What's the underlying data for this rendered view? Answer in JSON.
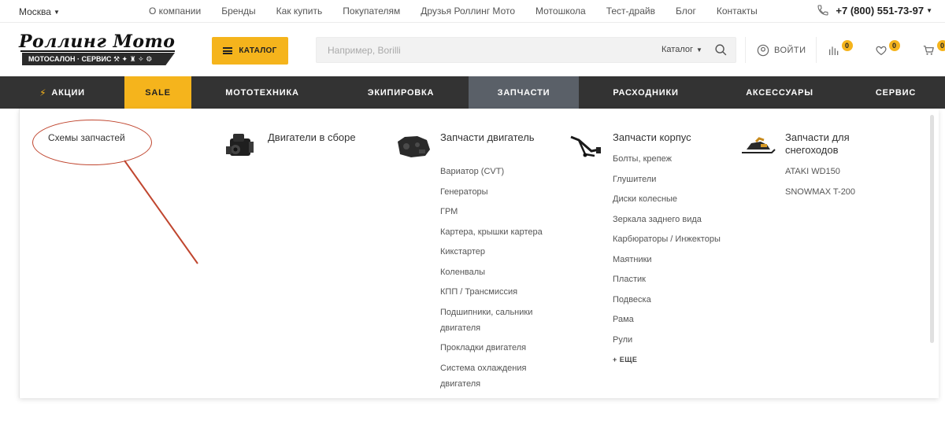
{
  "topbar": {
    "city": "Москва",
    "links": [
      "О компании",
      "Бренды",
      "Как купить",
      "Покупателям",
      "Друзья Роллинг Мото",
      "Мотошкола",
      "Тест-драйв",
      "Блог",
      "Контакты"
    ],
    "phone": "+7 (800) 551-73-97"
  },
  "logo": {
    "name": "Роллинг Мото",
    "tagline": "МОТОСАЛОН · СЕРВИС"
  },
  "header": {
    "catalog_label": "КАТАЛОГ",
    "search_placeholder": "Например, Borilli",
    "search_scope": "Каталог",
    "login_label": "ВОЙТИ",
    "compare_count": "0",
    "favorites_count": "0",
    "cart_count": "0"
  },
  "nav": [
    {
      "label": "АКЦИИ",
      "icon": "lightning-icon"
    },
    {
      "label": "SALE"
    },
    {
      "label": "МОТОТЕХНИКА"
    },
    {
      "label": "ЭКИПИРОВКА"
    },
    {
      "label": "ЗАПЧАСТИ"
    },
    {
      "label": "РАСХОДНИКИ"
    },
    {
      "label": "АКСЕССУАРЫ"
    },
    {
      "label": "СЕРВИС"
    }
  ],
  "dropdown": {
    "side_title": "Схемы запчастей",
    "columns": [
      {
        "title": "Двигатели в сборе",
        "image": "engine-assembly-image",
        "items": []
      },
      {
        "title": "Запчасти двигатель",
        "image": "engine-parts-image",
        "items": [
          "Вариатор (CVT)",
          "Генераторы",
          "ГРМ",
          "Картера, крышки картера",
          "Кикстартер",
          "Коленвалы",
          "КПП / Трансмиссия",
          "Подшипники, сальники двигателя",
          "Прокладки двигателя",
          "Система охлаждения двигателя"
        ]
      },
      {
        "title": "Запчасти корпус",
        "image": "frame-parts-image",
        "items": [
          "Болты, крепеж",
          "Глушители",
          "Диски колесные",
          "Зеркала заднего вида",
          "Карбюраторы / Инжекторы",
          "Маятники",
          "Пластик",
          "Подвеска",
          "Рама",
          "Рули"
        ],
        "more": "+ ЕЩЕ"
      },
      {
        "title": "Запчасти для снегоходов",
        "image": "snowmobile-image",
        "items": [
          "ATAKI WD150",
          "SNOWMAX T-200"
        ]
      }
    ]
  },
  "colors": {
    "accent": "#f5b41c",
    "nav_bg": "#333333",
    "nav_active": "#5a6068",
    "annotation": "#c0462f"
  }
}
